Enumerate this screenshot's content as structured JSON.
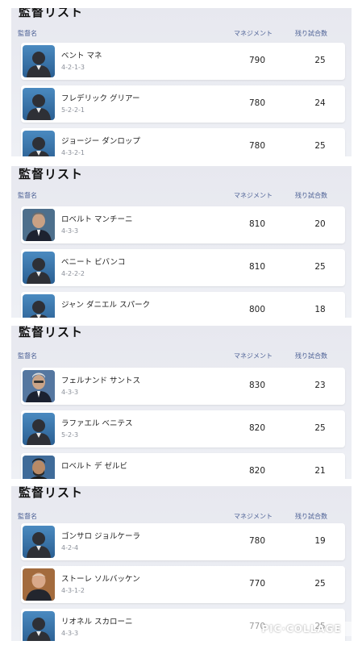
{
  "columns": {
    "name": "監督名",
    "management": "マネジメント",
    "remaining": "残り試合数"
  },
  "panels": [
    {
      "title": "監督リスト",
      "rows": [
        {
          "name": "ベント マネ",
          "formation": "4-2-1-3",
          "management": "790",
          "remaining": "25",
          "avatar": "silhouette-icon"
        },
        {
          "name": "フレデリック グリアー",
          "formation": "5-2-2-1",
          "management": "780",
          "remaining": "24",
          "avatar": "silhouette-icon"
        },
        {
          "name": "ジョージー ダンロップ",
          "formation": "4-3-2-1",
          "management": "780",
          "remaining": "25",
          "avatar": "silhouette-icon"
        }
      ]
    },
    {
      "title": "監督リスト",
      "rows": [
        {
          "name": "ロベルト マンチーニ",
          "formation": "4-3-3",
          "management": "810",
          "remaining": "20",
          "avatar": "manager-photo"
        },
        {
          "name": "ベニート ビバンコ",
          "formation": "4-2-2-2",
          "management": "810",
          "remaining": "25",
          "avatar": "silhouette-icon"
        },
        {
          "name": "ジャン ダニエル スパーク",
          "formation": "",
          "management": "800",
          "remaining": "18",
          "avatar": "silhouette-icon"
        }
      ]
    },
    {
      "title": "監督リスト",
      "rows": [
        {
          "name": "フェルナンド サントス",
          "formation": "4-3-3",
          "management": "830",
          "remaining": "23",
          "avatar": "manager-photo"
        },
        {
          "name": "ラファエル ベニテス",
          "formation": "5-2-3",
          "management": "820",
          "remaining": "25",
          "avatar": "silhouette-icon"
        },
        {
          "name": "ロベルト デ ゼルビ",
          "formation": "",
          "management": "820",
          "remaining": "21",
          "avatar": "manager-photo"
        }
      ]
    },
    {
      "title": "監督リスト",
      "rows": [
        {
          "name": "ゴンサロ ジョルケーラ",
          "formation": "4-2-4",
          "management": "780",
          "remaining": "19",
          "avatar": "silhouette-icon"
        },
        {
          "name": "ストーレ ソルバッケン",
          "formation": "4-3-1-2",
          "management": "770",
          "remaining": "25",
          "avatar": "manager-photo"
        },
        {
          "name": "リオネル スカローニ",
          "formation": "4-3-3",
          "management": "770",
          "remaining": "25",
          "avatar": "silhouette-icon"
        }
      ]
    }
  ],
  "watermark": "PIC·COLLAGE",
  "colors": {
    "header_text": "#4a5f94",
    "avatar_bg": "#3b77ad",
    "panel_bg": "#e9eaf0"
  }
}
